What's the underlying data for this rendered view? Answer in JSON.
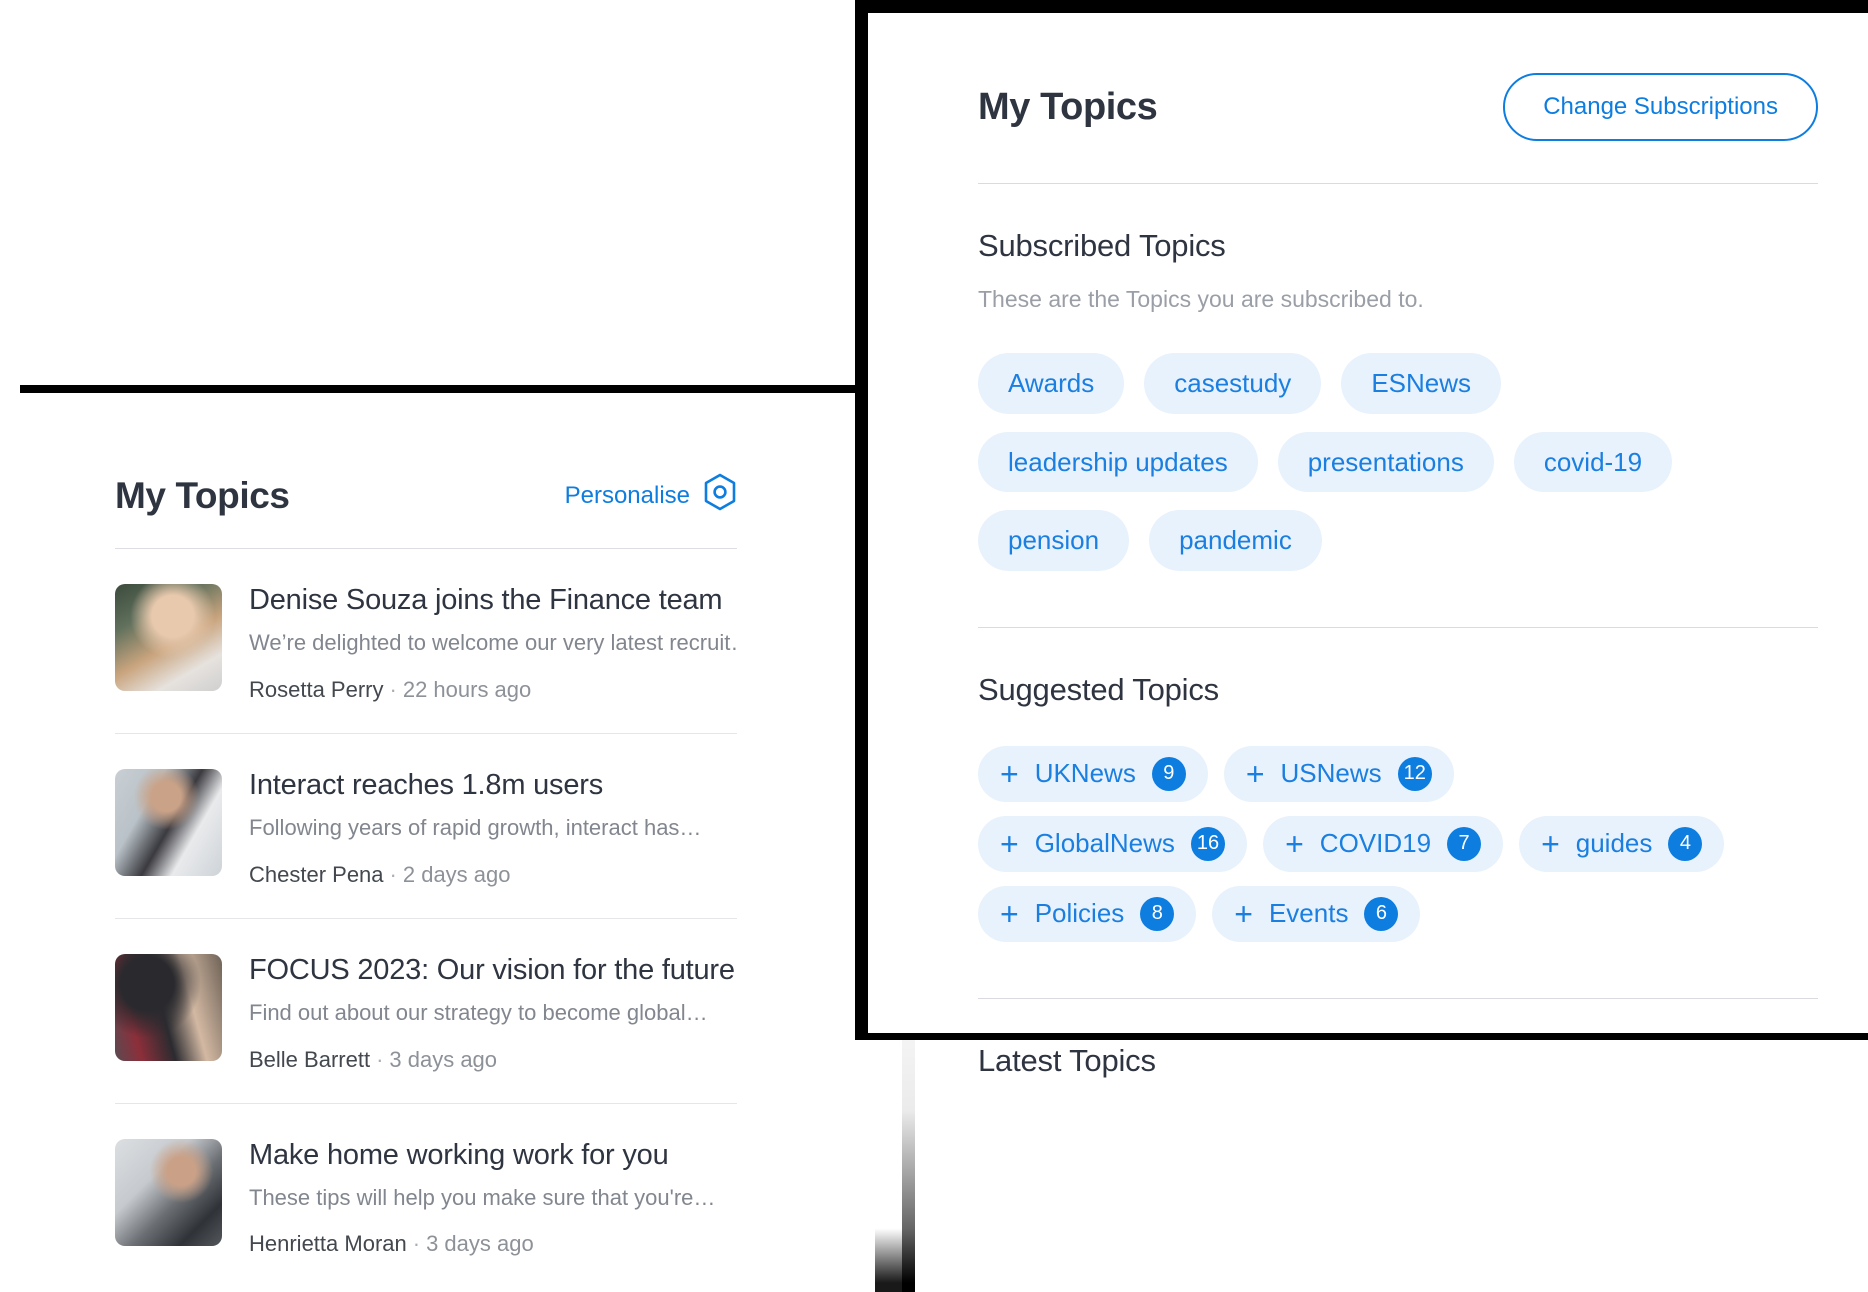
{
  "feed_card": {
    "title": "My Topics",
    "personalise_label": "Personalise",
    "personalise_icon": "hexagon-settings-icon",
    "articles": [
      {
        "title": "Denise Souza joins the Finance team",
        "excerpt": "We’re delighted to welcome our very latest recruit…",
        "author": "Rosetta Perry",
        "separator": "·",
        "time": "22 hours ago",
        "thumb": "woman-smiling-portrait"
      },
      {
        "title": "Interact reaches 1.8m users",
        "excerpt": "Following years of rapid growth, interact has…",
        "author": "Chester Pena",
        "separator": "·",
        "time": "2 days ago",
        "thumb": "woman-with-phone"
      },
      {
        "title": "FOCUS 2023: Our vision for the future",
        "excerpt": "Find out about our strategy to become global…",
        "author": "Belle Barrett",
        "separator": "·",
        "time": "3 days ago",
        "thumb": "people-clapping-meeting"
      },
      {
        "title": "Make home working work for you",
        "excerpt": "These tips will help you make sure that you're…",
        "author": "Henrietta Moran",
        "separator": "·",
        "time": "3 days ago",
        "thumb": "woman-on-sofa-laptop"
      }
    ]
  },
  "topics_card": {
    "title": "My Topics",
    "change_subscriptions_label": "Change Subscriptions",
    "subscribed": {
      "heading": "Subscribed Topics",
      "subtitle": "These are the Topics you are subscribed to.",
      "topics": [
        "Awards",
        "casestudy",
        "ESNews",
        "leadership updates",
        "presentations",
        "covid-19",
        "pension",
        "pandemic"
      ]
    },
    "suggested": {
      "heading": "Suggested Topics",
      "add_icon": "plus-icon",
      "topics": [
        {
          "label": "UKNews",
          "count": "9"
        },
        {
          "label": "USNews",
          "count": "12"
        },
        {
          "label": "GlobalNews",
          "count": "16"
        },
        {
          "label": "COVID19",
          "count": "7"
        },
        {
          "label": "guides",
          "count": "4"
        },
        {
          "label": "Policies",
          "count": "8"
        },
        {
          "label": "Events",
          "count": "6"
        }
      ]
    },
    "latest": {
      "heading": "Latest Topics"
    }
  },
  "colors": {
    "accent": "#0d7de0",
    "chip_bg": "#e8f2fc",
    "chip_text": "#1a7fe0",
    "heading": "#2e3440",
    "muted": "#9a9ea6"
  }
}
